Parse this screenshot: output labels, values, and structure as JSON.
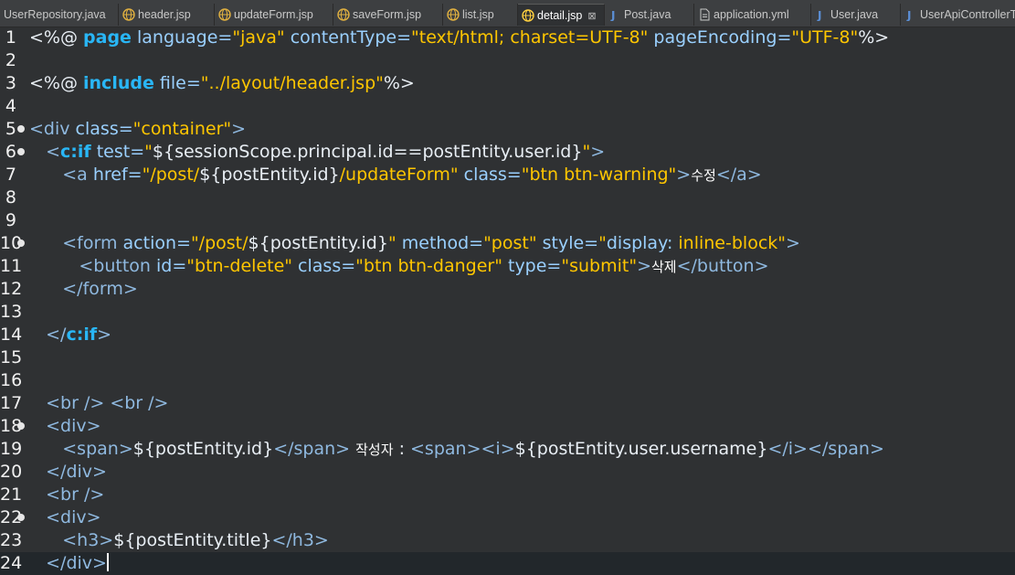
{
  "tabs": [
    {
      "label": "UserRepository.java",
      "icon": "java-file-icon"
    },
    {
      "label": "header.jsp",
      "icon": "jsp-file-icon"
    },
    {
      "label": "updateForm.jsp",
      "icon": "jsp-file-icon"
    },
    {
      "label": "saveForm.jsp",
      "icon": "jsp-file-icon"
    },
    {
      "label": "list.jsp",
      "icon": "jsp-file-icon"
    },
    {
      "label": "detail.jsp",
      "icon": "jsp-file-icon",
      "active": true
    },
    {
      "label": "Post.java",
      "icon": "java-file-icon"
    },
    {
      "label": "application.yml",
      "icon": "yml-file-icon"
    },
    {
      "label": "User.java",
      "icon": "java-file-icon"
    },
    {
      "label": "UserApiControllerTe",
      "icon": "java-file-icon"
    }
  ],
  "close_glyph": "⊠",
  "line_numbers": [
    "1",
    "2",
    "3",
    "4",
    "5",
    "6",
    "7",
    "8",
    "9",
    "10",
    "11",
    "12",
    "13",
    "14",
    "15",
    "16",
    "17",
    "18",
    "19",
    "20",
    "21",
    "22",
    "23",
    "24"
  ],
  "code_lines": [
    [
      {
        "c": "w",
        "t": "<%@ "
      },
      {
        "c": "k",
        "t": "page"
      },
      {
        "c": "a",
        "t": " language="
      },
      {
        "c": "s",
        "t": "\"java\""
      },
      {
        "c": "a",
        "t": " contentType="
      },
      {
        "c": "s",
        "t": "\"text/html; charset=UTF-8\""
      },
      {
        "c": "a",
        "t": " pageEncoding="
      },
      {
        "c": "s",
        "t": "\"UTF-8\""
      },
      {
        "c": "w",
        "t": "%>"
      }
    ],
    [],
    [
      {
        "c": "w",
        "t": "<%@ "
      },
      {
        "c": "k",
        "t": "include"
      },
      {
        "c": "a",
        "t": " file="
      },
      {
        "c": "s",
        "t": "\"../layout/header.jsp\""
      },
      {
        "c": "w",
        "t": "%>"
      }
    ],
    [],
    [
      {
        "c": "t",
        "t": "<div"
      },
      {
        "c": "a",
        "t": " class="
      },
      {
        "c": "s",
        "t": "\"container\""
      },
      {
        "c": "t",
        "t": ">"
      }
    ],
    [
      {
        "c": "w",
        "t": "   "
      },
      {
        "c": "t",
        "t": "<"
      },
      {
        "c": "k",
        "t": "c:if"
      },
      {
        "c": "a",
        "t": " test="
      },
      {
        "c": "s",
        "t": "\""
      },
      {
        "c": "w",
        "t": "${sessionScope.principal.id==postEntity.user.id}"
      },
      {
        "c": "s",
        "t": "\""
      },
      {
        "c": "t",
        "t": ">"
      }
    ],
    [
      {
        "c": "w",
        "t": "      "
      },
      {
        "c": "t",
        "t": "<a"
      },
      {
        "c": "a",
        "t": " href="
      },
      {
        "c": "s",
        "t": "\"/post/"
      },
      {
        "c": "w",
        "t": "${postEntity.id}"
      },
      {
        "c": "s",
        "t": "/updateForm\""
      },
      {
        "c": "a",
        "t": " class="
      },
      {
        "c": "s",
        "t": "\"btn btn-warning\""
      },
      {
        "c": "t",
        "t": ">"
      },
      {
        "c": "ko",
        "t": "수정"
      },
      {
        "c": "t",
        "t": "</a>"
      }
    ],
    [],
    [],
    [
      {
        "c": "w",
        "t": "      "
      },
      {
        "c": "t",
        "t": "<form"
      },
      {
        "c": "a",
        "t": " action="
      },
      {
        "c": "s",
        "t": "\"/post/"
      },
      {
        "c": "w",
        "t": "${postEntity.id}"
      },
      {
        "c": "s",
        "t": "\""
      },
      {
        "c": "a",
        "t": " method="
      },
      {
        "c": "s",
        "t": "\"post\""
      },
      {
        "c": "a",
        "t": " style="
      },
      {
        "c": "s",
        "t": "\""
      },
      {
        "c": "a",
        "t": "display: "
      },
      {
        "c": "s",
        "t": "inline-block\""
      },
      {
        "c": "t",
        "t": ">"
      }
    ],
    [
      {
        "c": "w",
        "t": "         "
      },
      {
        "c": "t",
        "t": "<button"
      },
      {
        "c": "a",
        "t": " id="
      },
      {
        "c": "s",
        "t": "\"btn-delete\""
      },
      {
        "c": "a",
        "t": " class="
      },
      {
        "c": "s",
        "t": "\"btn btn-danger\""
      },
      {
        "c": "a",
        "t": " type="
      },
      {
        "c": "s",
        "t": "\"submit\""
      },
      {
        "c": "t",
        "t": ">"
      },
      {
        "c": "ko",
        "t": "삭제"
      },
      {
        "c": "t",
        "t": "</button>"
      }
    ],
    [
      {
        "c": "w",
        "t": "      "
      },
      {
        "c": "t",
        "t": "</form>"
      }
    ],
    [],
    [
      {
        "c": "w",
        "t": "   "
      },
      {
        "c": "t",
        "t": "</"
      },
      {
        "c": "k",
        "t": "c:if"
      },
      {
        "c": "t",
        "t": ">"
      }
    ],
    [],
    [],
    [
      {
        "c": "w",
        "t": "   "
      },
      {
        "c": "t",
        "t": "<br /> <br />"
      }
    ],
    [
      {
        "c": "w",
        "t": "   "
      },
      {
        "c": "t",
        "t": "<div>"
      }
    ],
    [
      {
        "c": "w",
        "t": "      "
      },
      {
        "c": "t",
        "t": "<span>"
      },
      {
        "c": "w",
        "t": "${postEntity.id}"
      },
      {
        "c": "t",
        "t": "</span>"
      },
      {
        "c": "w",
        "t": " "
      },
      {
        "c": "ko",
        "t": "작성자"
      },
      {
        "c": "w",
        "t": " : "
      },
      {
        "c": "t",
        "t": "<span><i>"
      },
      {
        "c": "w",
        "t": "${postEntity.user.username}"
      },
      {
        "c": "t",
        "t": "</i></span>"
      }
    ],
    [
      {
        "c": "w",
        "t": "   "
      },
      {
        "c": "t",
        "t": "</div>"
      }
    ],
    [
      {
        "c": "w",
        "t": "   "
      },
      {
        "c": "t",
        "t": "<br />"
      }
    ],
    [
      {
        "c": "w",
        "t": "   "
      },
      {
        "c": "t",
        "t": "<div>"
      }
    ],
    [
      {
        "c": "w",
        "t": "      "
      },
      {
        "c": "t",
        "t": "<h3>"
      },
      {
        "c": "w",
        "t": "${postEntity.title}"
      },
      {
        "c": "t",
        "t": "</h3>"
      }
    ],
    [
      {
        "c": "w",
        "t": "   "
      },
      {
        "c": "t",
        "t": "</div>"
      }
    ]
  ],
  "fold_lines": [
    5,
    6,
    10,
    18,
    22
  ],
  "current_line": 24,
  "colors": {
    "tag": "#8fb9e0",
    "attr": "#9ad0ff",
    "string": "#ffc600",
    "keyword": "#29b6f6",
    "background": "#2f3133"
  }
}
